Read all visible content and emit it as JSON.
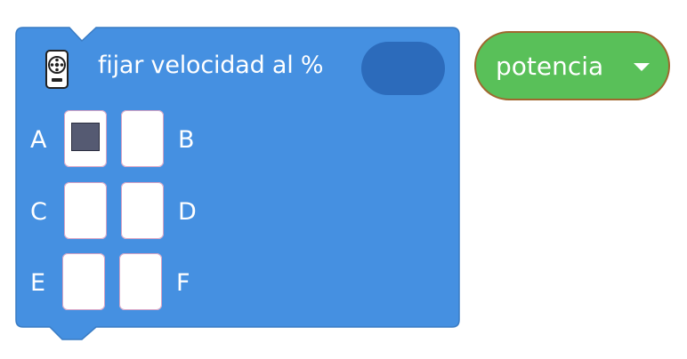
{
  "block": {
    "title": "fijar velocidad al %",
    "icon": "motor-icon",
    "color": "#4590e1",
    "value_slot_color": "#2c6bbb",
    "ports": [
      {
        "label": "A",
        "checked": true
      },
      {
        "label": "B",
        "checked": false
      },
      {
        "label": "C",
        "checked": false
      },
      {
        "label": "D",
        "checked": false
      },
      {
        "label": "E",
        "checked": false
      },
      {
        "label": "F",
        "checked": false
      }
    ]
  },
  "dropdown": {
    "label": "potencia",
    "icon": "caret-down-icon",
    "color": "#59c059"
  }
}
